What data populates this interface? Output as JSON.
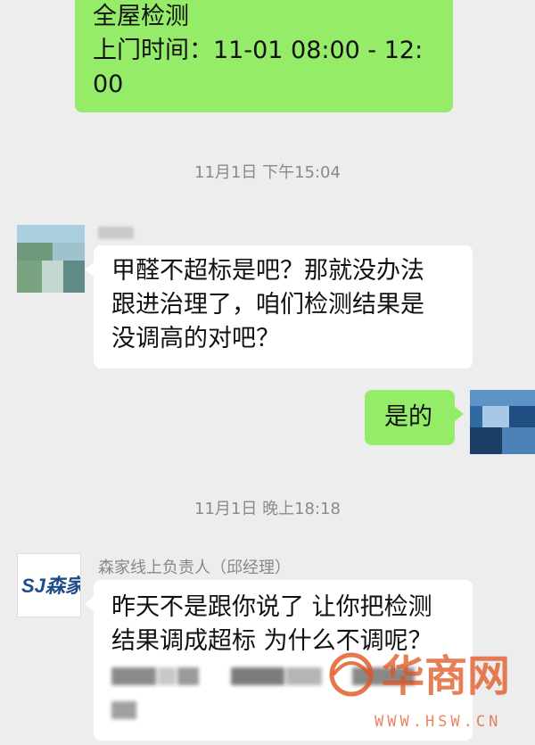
{
  "messages": {
    "order_line1": "全屋检测",
    "order_line2": "上门时间：11-01 08:00 - 12:",
    "order_line3": "00",
    "time1": "11月1日 下午15:04",
    "q_line1": "甲醛不超标是吧？那就没办法",
    "q_line2": "跟进治理了，咱们检测结果是",
    "q_line3": "没调高的对吧？",
    "reply": "是的",
    "time2": "11月1日 晚上18:18",
    "sender_name": "森家线上负责人（邱经理）",
    "sj_line1": "昨天不是跟你说了 让你把检测",
    "sj_line2": "结果调成超标 为什么不调呢？"
  },
  "logo": {
    "text": "SJ森家"
  },
  "watermark": {
    "text": "华商网",
    "url": "WWW.HSW.CN",
    "color": "#e0541e"
  },
  "colors": {
    "sent_bubble": "#95ec69",
    "received_bubble": "#ffffff",
    "background": "#ededed"
  }
}
